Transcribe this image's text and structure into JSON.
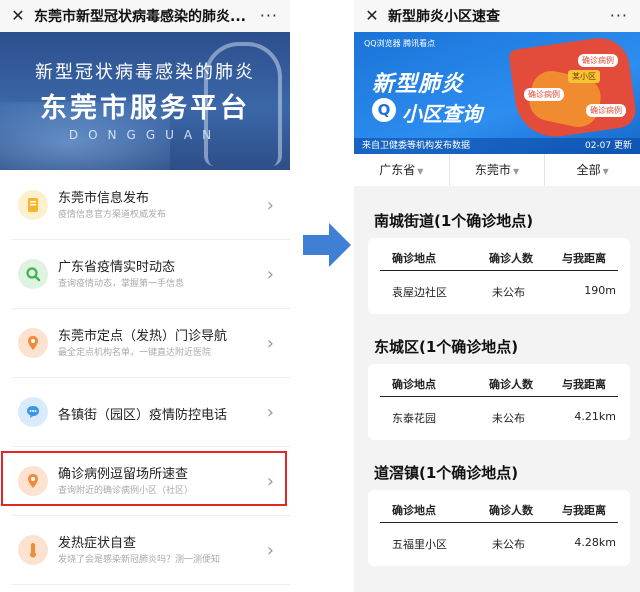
{
  "left": {
    "title": "东莞市新型冠状病毒感染的肺炎...",
    "more": "···",
    "banner": {
      "line1": "新型冠状病毒感染的肺炎",
      "line2": "东莞市服务平台",
      "line3": "DONGGUAN"
    },
    "menu": [
      {
        "name": "东莞市信息发布",
        "desc": "疫情信息官方渠道权威发布",
        "icon": "document-icon",
        "color": "#f7c64a",
        "bg": "#fdf0cc"
      },
      {
        "name": "广东省疫情实时动态",
        "desc": "查询疫情动态，掌握第一手信息",
        "icon": "search-icon",
        "color": "#4cbf5a",
        "bg": "#dff3e0"
      },
      {
        "name": "东莞市定点（发热）门诊导航",
        "desc": "最全定点机构名单，一键直达附近医院",
        "icon": "location-pin-icon",
        "color": "#f29a4a",
        "bg": "#fde3cf"
      },
      {
        "name": "各镇街（园区）疫情防控电话",
        "desc": "",
        "icon": "chat-icon",
        "color": "#3b95e8",
        "bg": "#d9ebfb"
      },
      {
        "name": "确诊病例逗留场所速查",
        "desc": "查询附近的确诊病例小区（社区）",
        "icon": "location-pin-icon",
        "color": "#f29a4a",
        "bg": "#fde3cf"
      },
      {
        "name": "发热症状自查",
        "desc": "发烧了会是感染新冠肺炎吗？测一测便知",
        "icon": "thermometer-icon",
        "color": "#f29a4a",
        "bg": "#fde3cf"
      }
    ]
  },
  "right": {
    "title": "新型肺炎小区速查",
    "more": "···",
    "banner": {
      "logos": "QQ浏览器  腾讯看点",
      "h1": "新型肺炎",
      "h2": "小区查询",
      "tag_a": "确诊病例",
      "tag_b": "某小区",
      "tag_c": "确诊病例",
      "tag_d": "确诊病例",
      "source": "来自卫健委等机构发布数据",
      "updated": "02-07 更新"
    },
    "filters": [
      "广东省",
      "东莞市",
      "全部"
    ],
    "columns": [
      "确诊地点",
      "确诊人数",
      "与我距离"
    ],
    "sections": [
      {
        "title": "南城街道(1个确诊地点)",
        "place": "袁屋边社区",
        "count": "未公布",
        "distance": "190m"
      },
      {
        "title": "东城区(1个确诊地点)",
        "place": "东泰花园",
        "count": "未公布",
        "distance": "4.21km"
      },
      {
        "title": "道滘镇(1个确诊地点)",
        "place": "五福里小区",
        "count": "未公布",
        "distance": "4.28km"
      }
    ]
  },
  "colors": {
    "highlight": "#e32727",
    "arrow": "#3f7fd4",
    "banner_blue": "#1b73d8"
  }
}
